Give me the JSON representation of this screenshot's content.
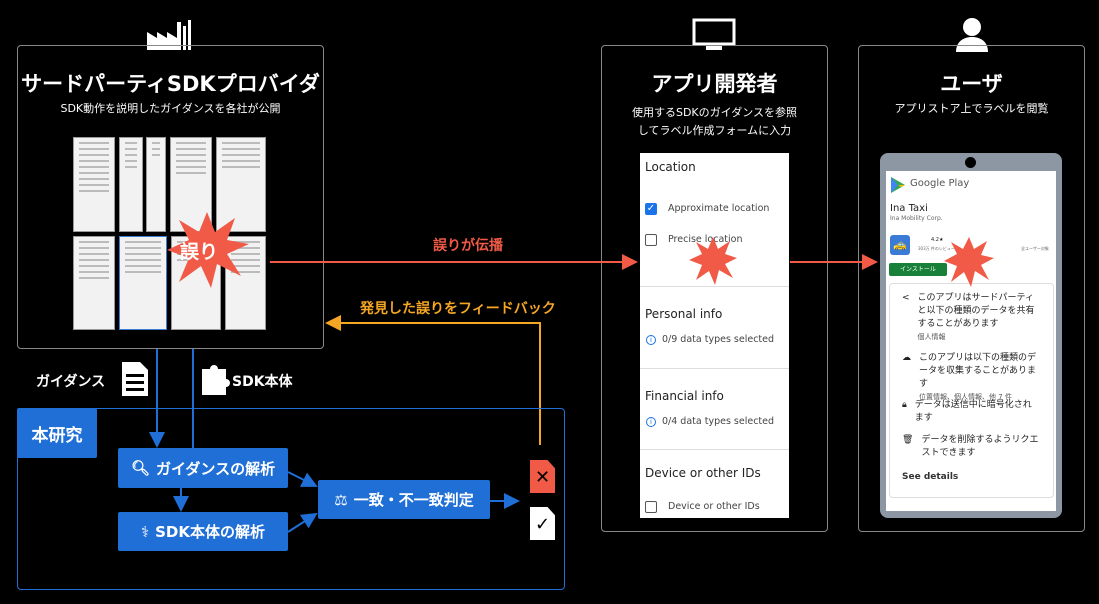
{
  "provider": {
    "title": "サードパーティSDKプロバイダ",
    "subtitle": "SDK動作を説明したガイダンスを各社が公開",
    "error_label": "誤り"
  },
  "developer": {
    "title": "アプリ開発者",
    "subtitle_line1": "使用するSDKのガイダンスを参照",
    "subtitle_line2": "してラベル作成フォームに入力"
  },
  "user": {
    "title": "ユーザ",
    "subtitle": "アプリストア上でラベルを閲覧"
  },
  "form": {
    "location_header": "Location",
    "approx": "Approximate location",
    "precise": "Precise location",
    "personal_header": "Personal info",
    "personal_count": "0/9 data types selected",
    "financial_header": "Financial info",
    "financial_count": "0/4 data types selected",
    "device_header": "Device or other IDs",
    "device_item": "Device or other IDs"
  },
  "store": {
    "brand": "Google Play",
    "app_name": "Ina Taxi",
    "developer": "Ina Mobility Corp.",
    "rating": "4.2★",
    "reviews": "303万 件のレビュー",
    "audience": "全ユーザー対象",
    "install": "インストール",
    "items": [
      {
        "text": "このアプリはサードパーティと以下の種類のデータを共有することがあります",
        "detail": "個人情報"
      },
      {
        "text": "このアプリは以下の種類のデータを収集することがあります",
        "detail": "位置情報、個人情報、他 7 件"
      },
      {
        "text": "データは送信中に暗号化されます",
        "detail": ""
      },
      {
        "text": "データを削除するようリクエストできます",
        "detail": ""
      }
    ],
    "see_details": "See details"
  },
  "arrows": {
    "propagate": "誤りが伝播",
    "feedback": "発見した誤りをフィードバック"
  },
  "inputs": {
    "guidance": "ガイダンス",
    "sdk": "SDK本体"
  },
  "research": {
    "tag": "本研究",
    "guidance_analysis": "ガイダンスの解析",
    "sdk_analysis": "SDK本体の解析",
    "judge": "一致・不一致判定"
  },
  "colors": {
    "blue": "#1f6fd6",
    "red": "#f05a46",
    "orange": "#f5a623"
  }
}
